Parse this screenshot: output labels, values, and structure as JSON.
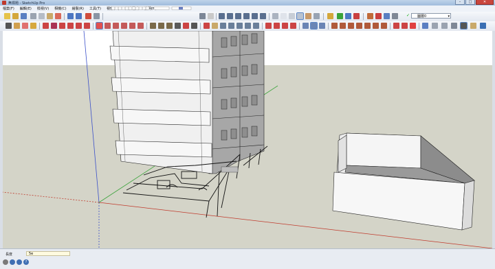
{
  "window": {
    "title": "無標題 - SketchUp Pro",
    "minimize": "–",
    "maximize": "□",
    "close": "✕"
  },
  "menu": {
    "items": [
      "檔案(F)",
      "編輯(E)",
      "檢視(V)",
      "相機(C)",
      "繪製(R)",
      "工具(T)",
      "視窗(W)",
      "外掛程式",
      "說明(H)"
    ]
  },
  "layers": {
    "selected": "圖層0"
  },
  "measurements": {
    "label": "長度",
    "value": "5e"
  },
  "colors": {
    "x_axis": "#c0392b",
    "y_axis": "#3aa33a",
    "z_axis": "#3a4fc9",
    "ground": "#d4d4c8",
    "building_front": "#f0f0f0",
    "building_side": "#a7a7a7"
  },
  "toolbar_icons": [
    "select-icon",
    "eraser-icon",
    "paint-icon",
    "line-icon",
    "arc-icon",
    "rectangle-icon",
    "circle-icon",
    "polygon-icon",
    "move-icon",
    "push-pull-icon",
    "rotate-icon",
    "follow-me-icon",
    "scale-icon",
    "offset-icon",
    "tape-measure-icon",
    "dimension-icon",
    "protractor-icon",
    "text-icon",
    "axes-icon",
    "3d-text-icon",
    "orbit-icon",
    "pan-icon",
    "zoom-icon",
    "zoom-window-icon",
    "zoom-extents-icon"
  ]
}
